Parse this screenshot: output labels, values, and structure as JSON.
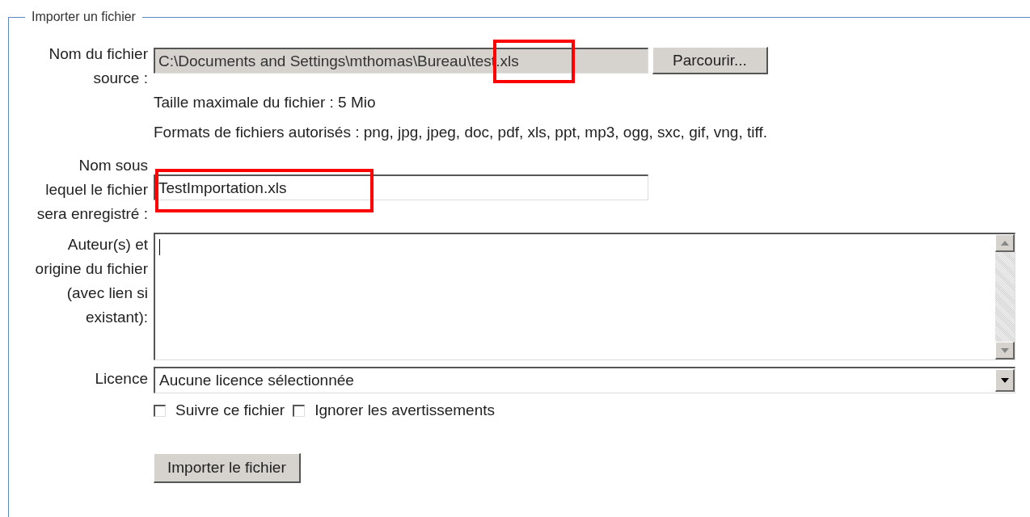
{
  "legend": "Importer un fichier",
  "source": {
    "label_lines": [
      "Nom du fichier",
      "source :"
    ],
    "value": "C:\\Documents and Settings\\mthomas\\Bureau\\test.xls",
    "button": "Parcourir...",
    "notes": [
      "Taille maximale du fichier : 5 Mio",
      "Formats de fichiers autorisés : png, jpg, jpeg, doc, pdf, xls, ppt, mp3, ogg, sxc, gif, vng, tiff."
    ]
  },
  "save_name": {
    "label_lines": [
      "Nom sous",
      "lequel le fichier",
      "sera enregistré :"
    ],
    "value": "TestImportation.xls"
  },
  "author": {
    "label_lines": [
      "Auteur(s) et",
      "origine du fichier",
      "(avec lien si",
      "existant):"
    ]
  },
  "license": {
    "label": "Licence",
    "value": "Aucune licence sélectionnée"
  },
  "options": [
    {
      "label": "Suivre ce fichier",
      "checked": false
    },
    {
      "label": "Ignorer les avertissements",
      "checked": false
    }
  ],
  "submit": "Importer le fichier"
}
